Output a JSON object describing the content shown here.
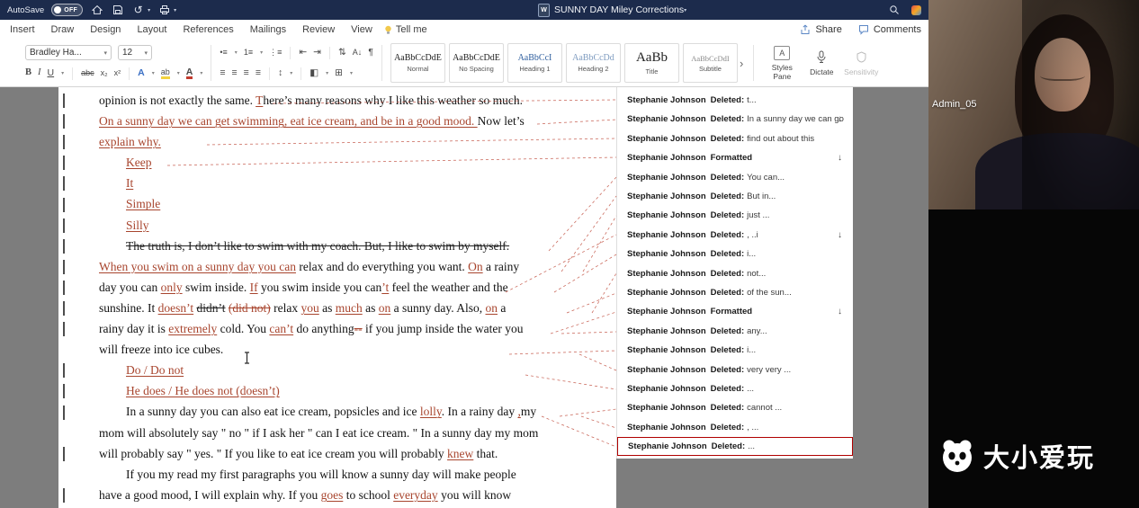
{
  "titlebar": {
    "autosave_label": "AutoSave",
    "autosave_state": "OFF",
    "doc_title": "SUNNY DAY Miley Corrections"
  },
  "tabs": [
    "Insert",
    "Draw",
    "Design",
    "Layout",
    "References",
    "Mailings",
    "Review",
    "View"
  ],
  "tellme_label": "Tell me",
  "share_label": "Share",
  "comments_label": "Comments",
  "ribbon": {
    "font_name": "Bradley Ha...",
    "font_size": "12",
    "styles": [
      {
        "sample": "AaBbCcDdE",
        "name": "Normal"
      },
      {
        "sample": "AaBbCcDdE",
        "name": "No Spacing"
      },
      {
        "sample": "AaBbCcI",
        "name": "Heading 1"
      },
      {
        "sample": "AaBbCcDd",
        "name": "Heading 2"
      },
      {
        "sample": "AaBb",
        "name": "Title"
      },
      {
        "sample": "AaBbCcDdI",
        "name": "Subtitle"
      }
    ],
    "styles_pane_label": "Styles Pane",
    "dictate_label": "Dictate",
    "sensitivity_label": "Sensitivity"
  },
  "icons": {
    "bold": "B",
    "italic": "I",
    "underline": "U",
    "strike": "abc",
    "subscript": "x₂",
    "superscript": "x²",
    "text_effects": "A",
    "highlight": "ab",
    "font_color": "A",
    "bullets": "•≡",
    "numbering": "1≡",
    "multilevel": "⋮≡",
    "outdent": "⇤",
    "indent": "⇥",
    "spacing": "⇅",
    "sort": "A↓",
    "pilcrow": "¶",
    "align_left": "≡",
    "align_center": "≡",
    "align_right": "≡",
    "justify": "≡",
    "line_spacing": "↕",
    "shading": "◧",
    "borders": "⊞",
    "gallery_more": "›",
    "caret": "▾",
    "undo": "↺",
    "arrow_down": "↓",
    "styles_pane_glyph": "A"
  },
  "document": {
    "lines": [
      {
        "ind": false,
        "runs": [
          {
            "t": "opinion is not exactly the same. ",
            "s": "n"
          },
          {
            "t": "T",
            "s": "i"
          },
          {
            "t": "here’s many reasons why I like this weather so much.",
            "s": "n"
          }
        ]
      },
      {
        "ind": false,
        "runs": [
          {
            "t": "On a sunny day we can get swimming, eat ice cream, and be in a good mood. ",
            "s": "i"
          },
          {
            "t": "Now let’s",
            "s": "n"
          }
        ]
      },
      {
        "ind": false,
        "runs": [
          {
            "t": "explain why.",
            "s": "i"
          }
        ]
      },
      {
        "ind": true,
        "runs": [
          {
            "t": "Keep",
            "s": "i"
          }
        ]
      },
      {
        "ind": true,
        "runs": [
          {
            "t": "It",
            "s": "i"
          }
        ]
      },
      {
        "ind": true,
        "runs": [
          {
            "t": "Simple",
            "s": "i"
          }
        ]
      },
      {
        "ind": true,
        "runs": [
          {
            "t": "Silly",
            "s": "i"
          }
        ]
      },
      {
        "ind": true,
        "runs": [
          {
            "t": "The truth is, I don’t like to swim with my coach. But, I like to swim by myself.",
            "s": "d"
          }
        ]
      },
      {
        "ind": false,
        "runs": [
          {
            "t": "When you swim on a sunny day you can",
            "s": "i"
          },
          {
            "t": " relax and do everything you want. ",
            "s": "n"
          },
          {
            "t": "On",
            "s": "i"
          },
          {
            "t": " a rainy",
            "s": "n"
          }
        ]
      },
      {
        "ind": false,
        "runs": [
          {
            "t": "day you can ",
            "s": "n"
          },
          {
            "t": "only",
            "s": "i"
          },
          {
            "t": " swim inside. ",
            "s": "n"
          },
          {
            "t": "If",
            "s": "i"
          },
          {
            "t": " you swim inside you can",
            "s": "n"
          },
          {
            "t": "’t",
            "s": "i"
          },
          {
            "t": " feel the weather and the",
            "s": "n"
          }
        ]
      },
      {
        "ind": false,
        "runs": [
          {
            "t": "sunshine. It ",
            "s": "n"
          },
          {
            "t": "doesn’t",
            "s": "i"
          },
          {
            "t": " ",
            "s": "n"
          },
          {
            "t": "didn’t",
            "s": "d"
          },
          {
            "t": " ",
            "s": "n"
          },
          {
            "t": "(did not)",
            "s": "rd"
          },
          {
            "t": " relax ",
            "s": "n"
          },
          {
            "t": "you",
            "s": "i"
          },
          {
            "t": " as ",
            "s": "n"
          },
          {
            "t": "much",
            "s": "i"
          },
          {
            "t": " as ",
            "s": "n"
          },
          {
            "t": "on",
            "s": "i"
          },
          {
            "t": " a sunny day. Also, ",
            "s": "n"
          },
          {
            "t": "on",
            "s": "i"
          },
          {
            "t": " a",
            "s": "n"
          }
        ]
      },
      {
        "ind": false,
        "runs": [
          {
            "t": "rainy day it is ",
            "s": "n"
          },
          {
            "t": "extremely",
            "s": "i"
          },
          {
            "t": " cold. You ",
            "s": "n"
          },
          {
            "t": "can’t",
            "s": "i"
          },
          {
            "t": " do anything",
            "s": "n"
          },
          {
            "t": "--",
            "s": "rd"
          },
          {
            "t": " if you jump inside the water you",
            "s": "n"
          }
        ]
      },
      {
        "ind": false,
        "runs": [
          {
            "t": "will freeze into ice cubes.",
            "s": "n"
          }
        ]
      },
      {
        "ind": true,
        "runs": [
          {
            "t": "Do / Do not",
            "s": "i"
          }
        ]
      },
      {
        "ind": true,
        "runs": [
          {
            "t": "He does / He does not (doesn’t)",
            "s": "i"
          }
        ]
      },
      {
        "ind": true,
        "runs": [
          {
            "t": "In a sunny day you can also eat ice cream, popsicles and ice ",
            "s": "n"
          },
          {
            "t": "lolly",
            "s": "i"
          },
          {
            "t": ". In a rainy day ",
            "s": "n"
          },
          {
            "t": ",",
            "s": "i"
          },
          {
            "t": "my",
            "s": "n"
          }
        ]
      },
      {
        "ind": false,
        "runs": [
          {
            "t": "mom will absolutely say \" no \" if I ask her \" can I eat ice cream. \" In a sunny day my mom",
            "s": "n"
          }
        ]
      },
      {
        "ind": false,
        "runs": [
          {
            "t": "will probably say \" yes. \" If you like to eat ice cream you will probably ",
            "s": "n"
          },
          {
            "t": "knew",
            "s": "i"
          },
          {
            "t": " that.",
            "s": "n"
          }
        ]
      },
      {
        "ind": true,
        "runs": [
          {
            "t": "If you my read my first paragraphs you will know a sunny day will make people",
            "s": "n"
          }
        ]
      },
      {
        "ind": false,
        "runs": [
          {
            "t": "have a good mood, I will explain why. If you ",
            "s": "n"
          },
          {
            "t": "goes",
            "s": "i"
          },
          {
            "t": " to school ",
            "s": "n"
          },
          {
            "t": "everyday",
            "s": "i"
          },
          {
            "t": " you will know",
            "s": "n"
          }
        ]
      }
    ]
  },
  "revisions": [
    {
      "author": "Stephanie Johnson",
      "action": "Deleted:",
      "text": "t...",
      "arrow": false
    },
    {
      "author": "Stephanie Johnson",
      "action": "Deleted:",
      "text": "In a sunny day we can go",
      "arrow": true
    },
    {
      "author": "Stephanie Johnson",
      "action": "Deleted:",
      "text": "find out about this",
      "arrow": false
    },
    {
      "author": "Stephanie Johnson",
      "action": "Formatted",
      "text": "",
      "arrow": true
    },
    {
      "author": "Stephanie Johnson",
      "action": "Deleted:",
      "text": "You can...",
      "arrow": false
    },
    {
      "author": "Stephanie Johnson",
      "action": "Deleted:",
      "text": "But in...",
      "arrow": false
    },
    {
      "author": "Stephanie Johnson",
      "action": "Deleted:",
      "text": "just ...",
      "arrow": false
    },
    {
      "author": "Stephanie Johnson",
      "action": "Deleted:",
      "text": ", ..i",
      "arrow": true
    },
    {
      "author": "Stephanie Johnson",
      "action": "Deleted:",
      "text": "i...",
      "arrow": false
    },
    {
      "author": "Stephanie Johnson",
      "action": "Deleted:",
      "text": "not...",
      "arrow": false
    },
    {
      "author": "Stephanie Johnson",
      "action": "Deleted:",
      "text": "of the sun...",
      "arrow": false
    },
    {
      "author": "Stephanie Johnson",
      "action": "Formatted",
      "text": "",
      "arrow": true
    },
    {
      "author": "Stephanie Johnson",
      "action": "Deleted:",
      "text": "any...",
      "arrow": false
    },
    {
      "author": "Stephanie Johnson",
      "action": "Deleted:",
      "text": "i...",
      "arrow": false
    },
    {
      "author": "Stephanie Johnson",
      "action": "Deleted:",
      "text": "very very ...",
      "arrow": false
    },
    {
      "author": "Stephanie Johnson",
      "action": "Deleted:",
      "text": "...",
      "arrow": false
    },
    {
      "author": "Stephanie Johnson",
      "action": "Deleted:",
      "text": "cannot ...",
      "arrow": false
    },
    {
      "author": "Stephanie Johnson",
      "action": "Deleted:",
      "text": ", ...",
      "arrow": false
    },
    {
      "author": "Stephanie Johnson",
      "action": "Deleted:",
      "text": "...",
      "arrow": false
    }
  ],
  "video": {
    "label": "Admin_05",
    "watermark": "大小爱玩"
  }
}
